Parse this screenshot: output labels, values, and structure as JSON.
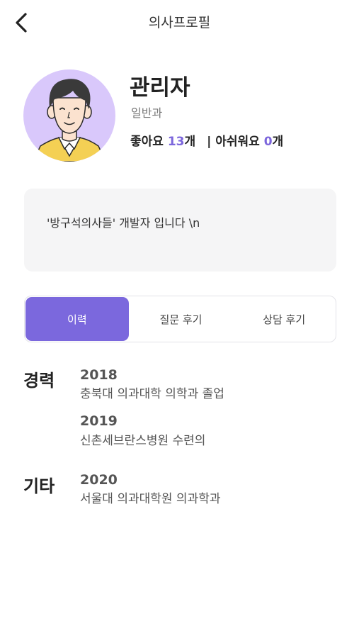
{
  "header": {
    "title": "의사프로필",
    "back_icon": "chevron-left-icon"
  },
  "profile": {
    "name": "관리자",
    "department": "일반과",
    "likes_label": "좋아요",
    "likes_count": "13",
    "likes_unit": "개",
    "separator": "|",
    "dislikes_label": "아쉬워요",
    "dislikes_count": "0",
    "dislikes_unit": "개",
    "avatar_icon": "doctor-avatar-illustration"
  },
  "intro": {
    "text": "'방구석의사들' 개발자 입니다 \\n"
  },
  "tabs": [
    {
      "label": "이력",
      "active": true
    },
    {
      "label": "질문 후기",
      "active": false
    },
    {
      "label": "상담 후기",
      "active": false
    }
  ],
  "history": {
    "career_label": "경력",
    "career": [
      {
        "year": "2018",
        "desc": "충북대 의과대학 의학과 졸업"
      },
      {
        "year": "2019",
        "desc": "신촌세브란스병원 수련의"
      }
    ],
    "etc_label": "기타",
    "etc": [
      {
        "year": "2020",
        "desc": "서울대 의과대학원 의과학과"
      }
    ]
  },
  "colors": {
    "accent": "#7b68dd",
    "avatar_bg": "#d9c8fb",
    "intro_bg": "#f5f5f6"
  }
}
